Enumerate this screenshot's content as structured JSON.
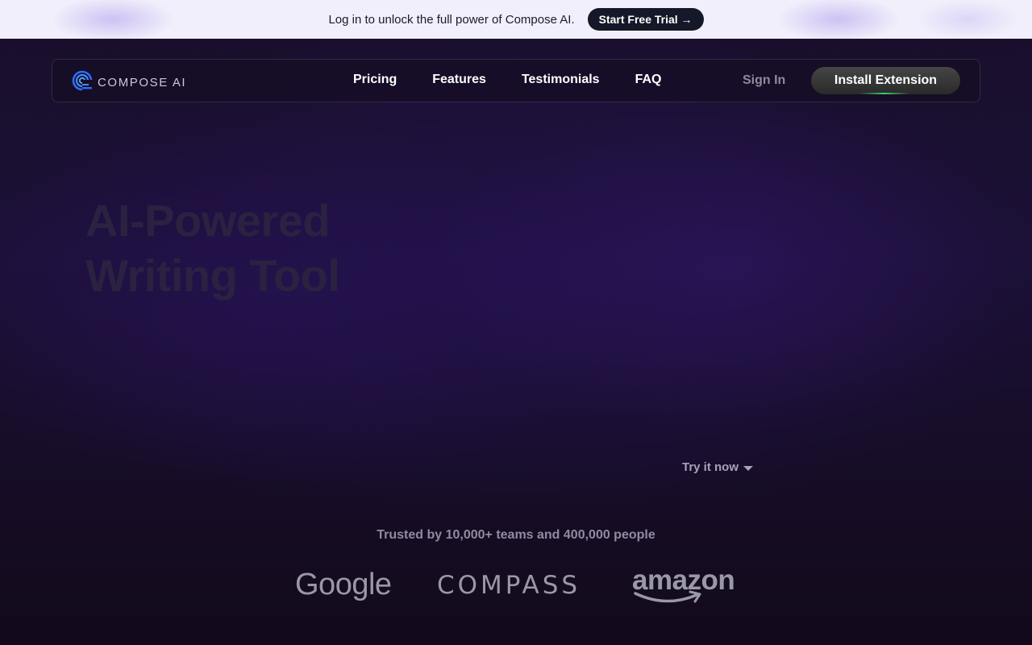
{
  "promo": {
    "text": "Log in to unlock the full power of Compose AI.",
    "cta_label": "Start Free Trial →"
  },
  "nav": {
    "logo_text": "COMPOSE AI",
    "links": [
      "Pricing",
      "Features",
      "Testimonials",
      "FAQ"
    ],
    "signin_label": "Sign In",
    "install_label": "Install Extension"
  },
  "hero": {
    "title_line1": "AI-Powered",
    "title_line2": "Writing Tool",
    "try_label": "Try it now"
  },
  "trusted": {
    "text": "Trusted by 10,000+ teams and 400,000 people",
    "brands": [
      "Google",
      "COMPASS",
      "amazon"
    ]
  },
  "colors": {
    "background": "#130b1e",
    "accent_green": "#38d25a",
    "logo_blue": "#2f6bff"
  }
}
